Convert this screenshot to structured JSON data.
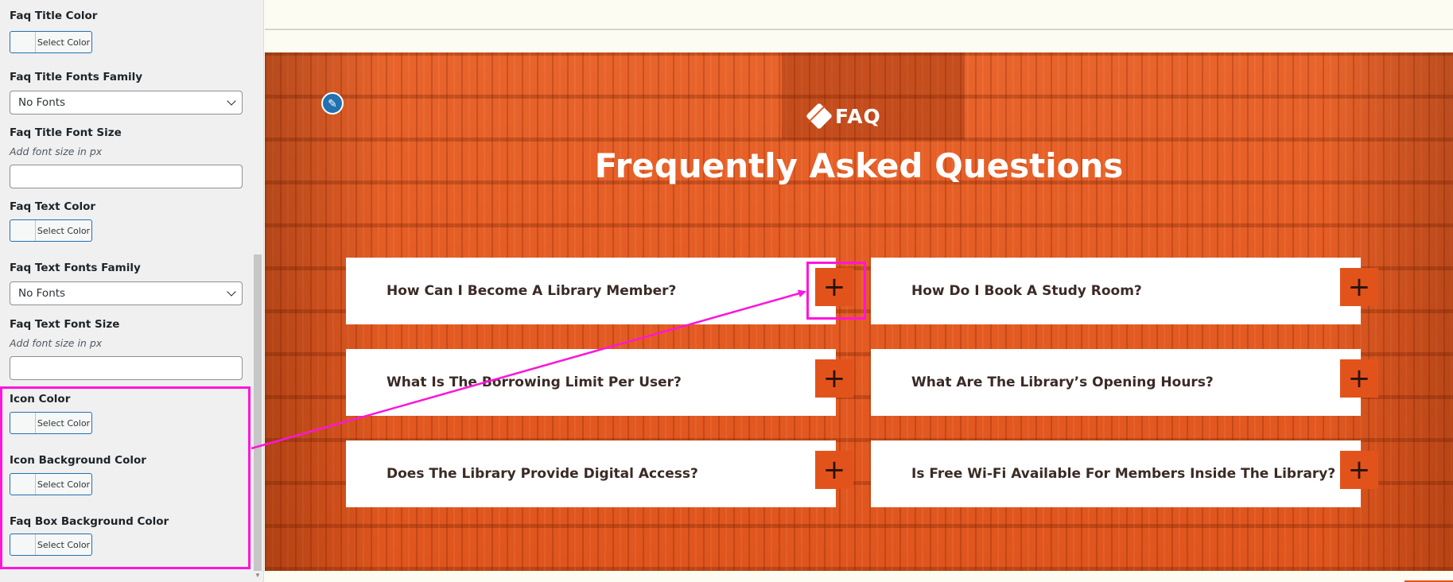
{
  "sidebar": {
    "faq_title_color": {
      "label": "Faq Title Color",
      "button": "Select Color"
    },
    "faq_title_fonts_family": {
      "label": "Faq Title Fonts Family",
      "value": "No Fonts"
    },
    "faq_title_font_size": {
      "label": "Faq Title Font Size",
      "hint": "Add font size in px",
      "value": ""
    },
    "faq_text_color": {
      "label": "Faq Text Color",
      "button": "Select Color"
    },
    "faq_text_fonts_family": {
      "label": "Faq Text Fonts Family",
      "value": "No Fonts"
    },
    "faq_text_font_size": {
      "label": "Faq Text Font Size",
      "hint": "Add font size in px",
      "value": ""
    },
    "icon_color": {
      "label": "Icon Color",
      "button": "Select Color"
    },
    "icon_background_color": {
      "label": "Icon Background Color",
      "button": "Select Color"
    },
    "faq_box_background_color": {
      "label": "Faq Box Background Color",
      "button": "Select Color"
    }
  },
  "preview": {
    "kicker": "FAQ",
    "heading": "Frequently Asked Questions",
    "questions": [
      {
        "text": "How Can I Become A Library Member?",
        "icon": "+"
      },
      {
        "text": "How Do I Book A Study Room?",
        "icon": "+"
      },
      {
        "text": "What Is The Borrowing Limit Per User?",
        "icon": "+"
      },
      {
        "text": "What Are The Library’s Opening Hours?",
        "icon": "+"
      },
      {
        "text": "Does The Library Provide Digital Access?",
        "icon": "+"
      },
      {
        "text": "Is Free Wi-Fi Available For Members Inside The Library?",
        "icon": "+"
      }
    ]
  },
  "colors": {
    "accent": "#e2531b",
    "highlight": "#ff15d9",
    "wp_blue": "#2271b1"
  },
  "icons": {
    "edit": "pencil-icon",
    "kicker": "diamond-book-icon",
    "faq_toggle": "plus-icon",
    "select": "chevron-down-icon"
  }
}
